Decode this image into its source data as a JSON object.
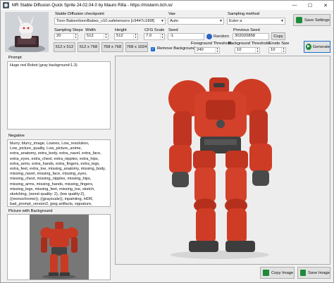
{
  "window": {
    "title": "MR Stable Diffusion Quick Sprite 24.02.04.0 by Mauro Rilla - https://misterm.itch.io/",
    "controls": [
      "—",
      "☐",
      "✕"
    ]
  },
  "checkpoint": {
    "label": "Stable Diffusion checkpoint",
    "value": "Toon Babes\\toonBabes_v10.safetensors [c9447c189f]"
  },
  "vae": {
    "label": "Vae",
    "value": "Auto"
  },
  "sampling": {
    "label": "Sampling method",
    "value": "Euler a"
  },
  "save_settings": {
    "label": "Save Settings"
  },
  "steps": {
    "label": "Sampling Steps",
    "value": "20"
  },
  "width": {
    "label": "Width",
    "value": "512"
  },
  "height": {
    "label": "Height",
    "value": "512"
  },
  "cfg": {
    "label": "CFG Scale",
    "value": "7.0"
  },
  "seed": {
    "label": "Seed",
    "value": "-1"
  },
  "random_button": {
    "label": "Random"
  },
  "previous_seed": {
    "label": "Previous Seed",
    "value": "302020858"
  },
  "copy_button": {
    "label": "Copy"
  },
  "presets": [
    "512 x 512",
    "512 x 768",
    "768 x 768",
    "768 x 1024"
  ],
  "remove_background": {
    "label": "Remove Background",
    "checked": true
  },
  "foreground_threshold": {
    "label": "Foreground Threshold",
    "value": "240"
  },
  "background_threshold": {
    "label": "Background Threshold",
    "value": "10"
  },
  "erode_size": {
    "label": "Erode Size",
    "value": "10"
  },
  "generate_button": {
    "label": "Generate"
  },
  "prompt": {
    "label": "Prompt",
    "text": "Huge red Robot (gray background:1.3)"
  },
  "negative": {
    "label": "Negative",
    "text": "blurry, blurry_image, Lowres, Low_resolution, Low_picture_quality, Low_picture_anime, extra_anatomy, extra_body, extra_navel, extra_face, extra_eyes, extra_chest, extra_nipples, extra_hips, extra_arms, extra_hands, extra_fingers, extra_legs, extra_feet, extra_toe, missing_anatomy, missing_body, missing_navel, missing_face, missing_eyes, missing_chest, missing_nipples, missing_hips, missing_arms, missing_hands, missing_fingers, missing_legs, missing_feet, missing_toe, sketch, sketching, (worst quality: 2), (low quality:2), ((monochrome)), ((grayscale)), inpainting, HDR, bad_prompt_version2, jpeg artifacts, signature, watermark, text, error, missing fingers,girl"
  },
  "picture_with_background": {
    "label": "Picture with Background"
  },
  "copy_image_button": {
    "label": "Copy Image"
  },
  "save_image_button": {
    "label": "Save Image"
  },
  "colors": {
    "accent_green": "#1e8a3a",
    "robot_red": "#cc3a26",
    "checkbox_blue": "#1a6fd0"
  }
}
